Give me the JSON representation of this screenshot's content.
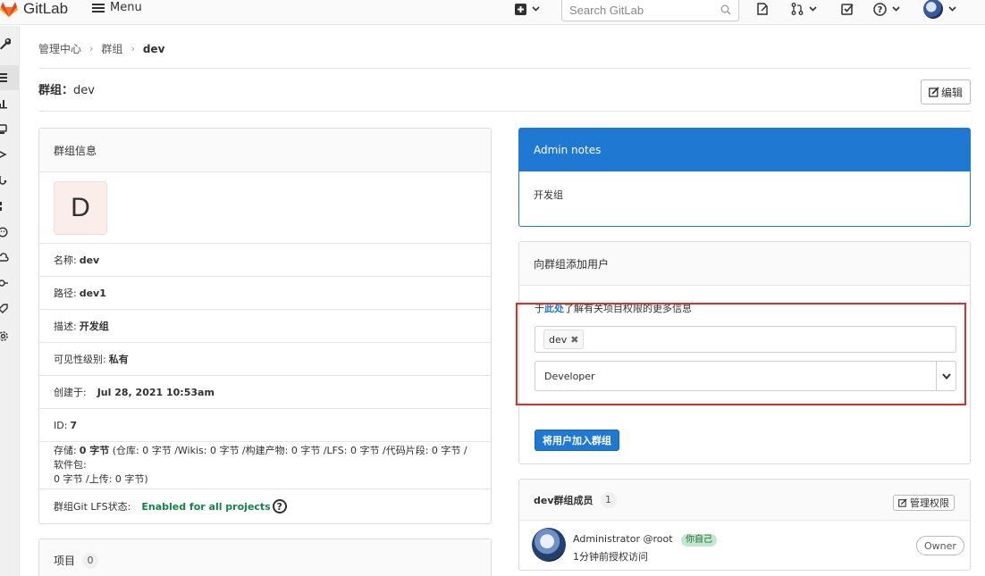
{
  "app": {
    "name": "GitLab",
    "menu_label": "Menu"
  },
  "search": {
    "placeholder": "Search GitLab"
  },
  "icons": {
    "logo": "gitlab-tanuki-icon",
    "menu": "hamburger-icon",
    "new": "plus-square-icon",
    "search": "search-icon",
    "issues": "issues-icon",
    "merge_requests": "merge-request-icon",
    "todos": "todo-icon",
    "help": "help-icon",
    "caret": "chevron-down-icon"
  },
  "sidebar": {
    "items": [
      {
        "name": "admin-wrench-icon"
      },
      {
        "name": "overview-list-icon"
      },
      {
        "name": "analytics-chart-icon"
      },
      {
        "name": "monitoring-icon"
      },
      {
        "name": "messages-icon"
      },
      {
        "name": "hooks-icon"
      },
      {
        "name": "applications-icon"
      },
      {
        "name": "abuse-reports-icon"
      },
      {
        "name": "cloud-icon"
      },
      {
        "name": "deploy-keys-icon"
      },
      {
        "name": "labels-icon"
      },
      {
        "name": "settings-gear-icon"
      }
    ]
  },
  "breadcrumb": [
    "管理中心",
    "群组",
    "dev"
  ],
  "page": {
    "title_prefix": "群组：",
    "title_name": "dev",
    "edit_label": "编辑"
  },
  "group_info": {
    "header": "群组信息",
    "avatar_letter": "D",
    "name_label": "名称:",
    "name_value": "dev",
    "path_label": "路径:",
    "path_value": "dev1",
    "desc_label": "描述:",
    "desc_value": "开发组",
    "visibility_label": "可见性级别:",
    "visibility_value": "私有",
    "created_label": "创建于:",
    "created_value": "Jul 28, 2021 10:53am",
    "id_label": "ID:",
    "id_value": "7",
    "storage_label": "存储:",
    "storage_value": "0 字节",
    "storage_detail_line1": "(仓库: 0 字节 /Wikis: 0 字节 /构建产物: 0 字节 /LFS: 0 字节 /代码片段: 0 字节 /软件包:",
    "storage_detail_line2": "0 字节 /上传: 0 字节)",
    "lfs_label": "群组Git LFS状态:",
    "lfs_value": "Enabled for all projects"
  },
  "projects": {
    "header": "项目",
    "count": "0"
  },
  "admin_notes": {
    "header": "Admin notes",
    "body": "开发组"
  },
  "add_user": {
    "header": "向群组添加用户",
    "hint_prefix": "于",
    "hint_link": "此处",
    "hint_suffix": "了解有关项目权限的更多信息",
    "token": "dev",
    "role": "Developer",
    "submit": "将用户加入群组"
  },
  "members": {
    "header": "dev群组成员",
    "count": "1",
    "manage_label": "管理权限",
    "list": [
      {
        "name": "Administrator",
        "username": "@root",
        "self_badge": "你自己",
        "access_text": "1分钟前授权访问",
        "role": "Owner"
      }
    ]
  }
}
